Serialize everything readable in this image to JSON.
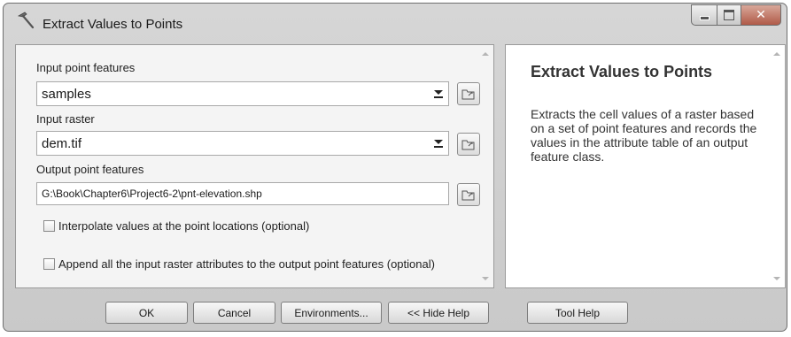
{
  "window": {
    "title": "Extract Values to Points",
    "icon": "tool-hammer-icon"
  },
  "form": {
    "input_point_label": "Input point features",
    "input_point_value": "samples",
    "input_raster_label": "Input raster",
    "input_raster_value": "dem.tif",
    "output_label": "Output point features",
    "output_value": "G:\\Book\\Chapter6\\Project6-2\\pnt-elevation.shp",
    "interpolate_label": "Interpolate values at the point locations (optional)",
    "interpolate_checked": false,
    "append_label": "Append all the input raster attributes to the output point features (optional)",
    "append_checked": false
  },
  "help": {
    "title": "Extract Values to Points",
    "body": "Extracts the cell values of a raster based on a set of point features and records the values in the attribute table of an output feature class."
  },
  "buttons": {
    "ok": "OK",
    "cancel": "Cancel",
    "environments": "Environments...",
    "hide_help": "<< Hide Help",
    "tool_help": "Tool Help"
  }
}
